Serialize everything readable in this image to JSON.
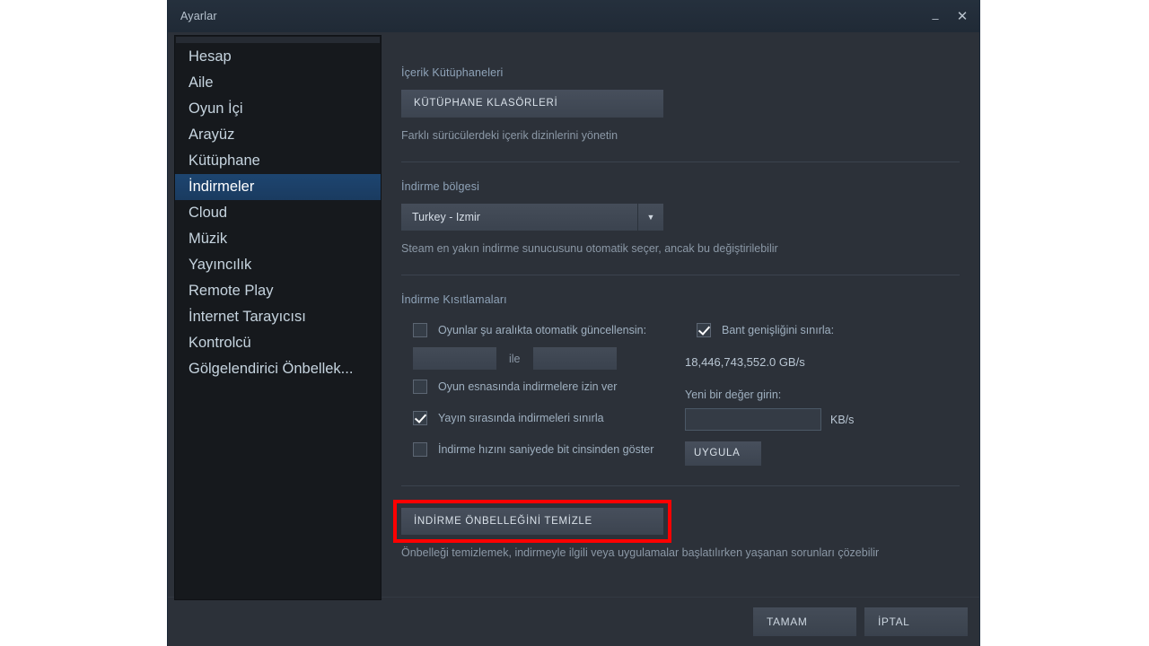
{
  "window": {
    "title": "Ayarlar",
    "minimize_icon": "minimize-icon",
    "minimize_glyph": "–",
    "close_icon": "close-icon",
    "close_glyph": "✕"
  },
  "sidebar": {
    "items": [
      {
        "label": "Hesap",
        "selected": false
      },
      {
        "label": "Aile",
        "selected": false
      },
      {
        "label": "Oyun İçi",
        "selected": false
      },
      {
        "label": "Arayüz",
        "selected": false
      },
      {
        "label": "Kütüphane",
        "selected": false
      },
      {
        "label": "İndirmeler",
        "selected": true
      },
      {
        "label": "Cloud",
        "selected": false
      },
      {
        "label": "Müzik",
        "selected": false
      },
      {
        "label": "Yayıncılık",
        "selected": false
      },
      {
        "label": "Remote Play",
        "selected": false
      },
      {
        "label": "İnternet Tarayıcısı",
        "selected": false
      },
      {
        "label": "Kontrolcü",
        "selected": false
      },
      {
        "label": "Gölgelendirici Önbellek...",
        "selected": false
      }
    ]
  },
  "main": {
    "content_libraries": {
      "label": "İçerik Kütüphaneleri",
      "button_label": "KÜTÜPHANE KLASÖRLERİ",
      "hint": "Farklı sürücülerdeki içerik dizinlerini yönetin"
    },
    "download_region": {
      "label": "İndirme bölgesi",
      "selected_value": "Turkey - Izmir",
      "dropdown_arrow": "chevron-down-icon",
      "arrow_glyph": "▼",
      "hint": "Steam en yakın indirme sunucusunu otomatik seçer, ancak bu değiştirilebilir"
    },
    "download_restrictions": {
      "label": "İndirme Kısıtlamaları",
      "auto_update_schedule": {
        "label": "Oyunlar şu aralıkta otomatik güncellensin:",
        "checked": false,
        "start_value": "",
        "separator_label": "ile",
        "end_value": ""
      },
      "allow_downloads_during_gameplay": {
        "label": "Oyun esnasında indirmelere izin ver",
        "checked": false
      },
      "throttle_downloads_while_streaming": {
        "label": "Yayın sırasında indirmeleri sınırla",
        "checked": true
      },
      "display_rate_in_bits": {
        "label": "İndirme hızını saniyede bit cinsinden göster",
        "checked": false
      },
      "limit_bandwidth": {
        "label": "Bant genişliğini sınırla:",
        "checked": true,
        "current_value": "18,446,743,552.0 GB/s",
        "new_value_label": "Yeni bir değer girin:",
        "new_value": "",
        "new_value_placeholder": "",
        "unit": "KB/s",
        "apply_label": "UYGULA"
      }
    },
    "clear_cache": {
      "button_label": "İNDİRME ÖNBELLEĞİNİ TEMİZLE",
      "hint": "Önbelleği temizlemek, indirmeyle ilgili veya uygulamalar başlatılırken yaşanan sorunları çözebilir",
      "highlight_color": "#ff0000"
    }
  },
  "footer": {
    "ok_label": "TAMAM",
    "cancel_label": "İPTAL"
  }
}
